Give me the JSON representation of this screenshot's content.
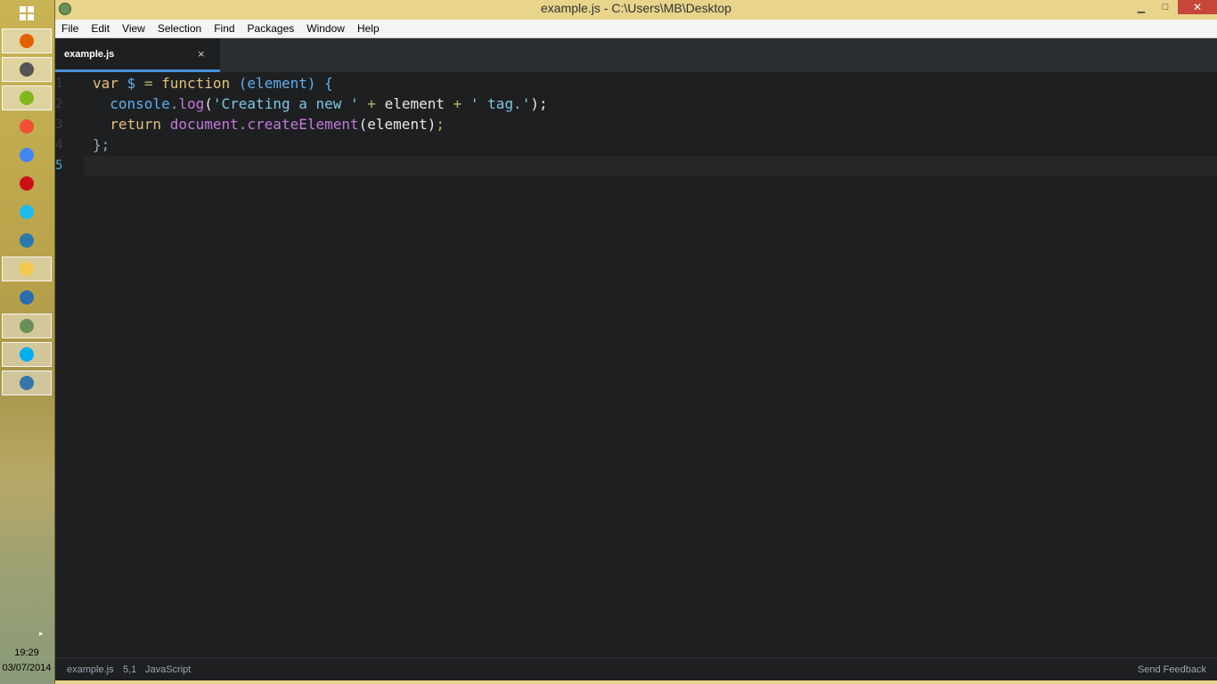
{
  "taskbar": {
    "apps": [
      {
        "icon": "firefox-icon",
        "color": "#e66000",
        "active": true
      },
      {
        "icon": "monitor-app-icon",
        "color": "#555555",
        "active": true
      },
      {
        "icon": "spotify-icon",
        "color": "#81b71a",
        "active": true
      },
      {
        "icon": "git-icon",
        "color": "#f05033",
        "active": false
      },
      {
        "icon": "chrome-icon",
        "color": "#4285f4",
        "active": false
      },
      {
        "icon": "opera-icon",
        "color": "#cc0f16",
        "active": false
      },
      {
        "icon": "internet-explorer-icon",
        "color": "#1ebbee",
        "active": false
      },
      {
        "icon": "network-app-icon",
        "color": "#2a7ab0",
        "active": false
      },
      {
        "icon": "file-explorer-icon",
        "color": "#f2c94c",
        "active": true
      },
      {
        "icon": "control-panel-icon",
        "color": "#2b6cb0",
        "active": false
      },
      {
        "icon": "atom-icon",
        "color": "#6a8f5b",
        "active": true
      },
      {
        "icon": "skype-icon",
        "color": "#00aff0",
        "active": true
      },
      {
        "icon": "python-icon",
        "color": "#3776ab",
        "active": true
      }
    ],
    "clock_time": "19:29",
    "clock_date": "03/07/2014"
  },
  "window": {
    "title": "example.js - C:\\Users\\MB\\Desktop",
    "minimize": "▁",
    "maximize": "□",
    "close": "✕"
  },
  "menu": [
    "File",
    "Edit",
    "View",
    "Selection",
    "Find",
    "Packages",
    "Window",
    "Help"
  ],
  "tab": {
    "label": "example.js",
    "close": "×"
  },
  "editor": {
    "line_numbers": [
      "1",
      "2",
      "3",
      "4",
      "5"
    ],
    "current_line": 5,
    "lines": [
      [
        {
          "t": "var",
          "c": "kw"
        },
        {
          "t": " ",
          "c": "var"
        },
        {
          "t": "$",
          "c": "fn"
        },
        {
          "t": " = ",
          "c": "op"
        },
        {
          "t": "function",
          "c": "kw"
        },
        {
          "t": " (element) {",
          "c": "fn"
        }
      ],
      [
        {
          "t": "  ",
          "c": "var"
        },
        {
          "t": "console",
          "c": "fn"
        },
        {
          "t": ".",
          "c": "punct"
        },
        {
          "t": "log",
          "c": "purple"
        },
        {
          "t": "(",
          "c": "var"
        },
        {
          "t": "'Creating a new '",
          "c": "str"
        },
        {
          "t": " + ",
          "c": "op"
        },
        {
          "t": "element",
          "c": "var"
        },
        {
          "t": " + ",
          "c": "op"
        },
        {
          "t": "' tag.'",
          "c": "str"
        },
        {
          "t": ");",
          "c": "var"
        }
      ],
      [
        {
          "t": "  ",
          "c": "var"
        },
        {
          "t": "return",
          "c": "ret"
        },
        {
          "t": " ",
          "c": "var"
        },
        {
          "t": "document",
          "c": "purple"
        },
        {
          "t": ".",
          "c": "punct"
        },
        {
          "t": "createElement",
          "c": "purple"
        },
        {
          "t": "(element)",
          "c": "var"
        },
        {
          "t": ";",
          "c": "op"
        }
      ],
      [
        {
          "t": "};",
          "c": "punct"
        }
      ],
      []
    ]
  },
  "status": {
    "file": "example.js",
    "position": "5,1",
    "grammar": "JavaScript",
    "feedback": "Send Feedback"
  }
}
